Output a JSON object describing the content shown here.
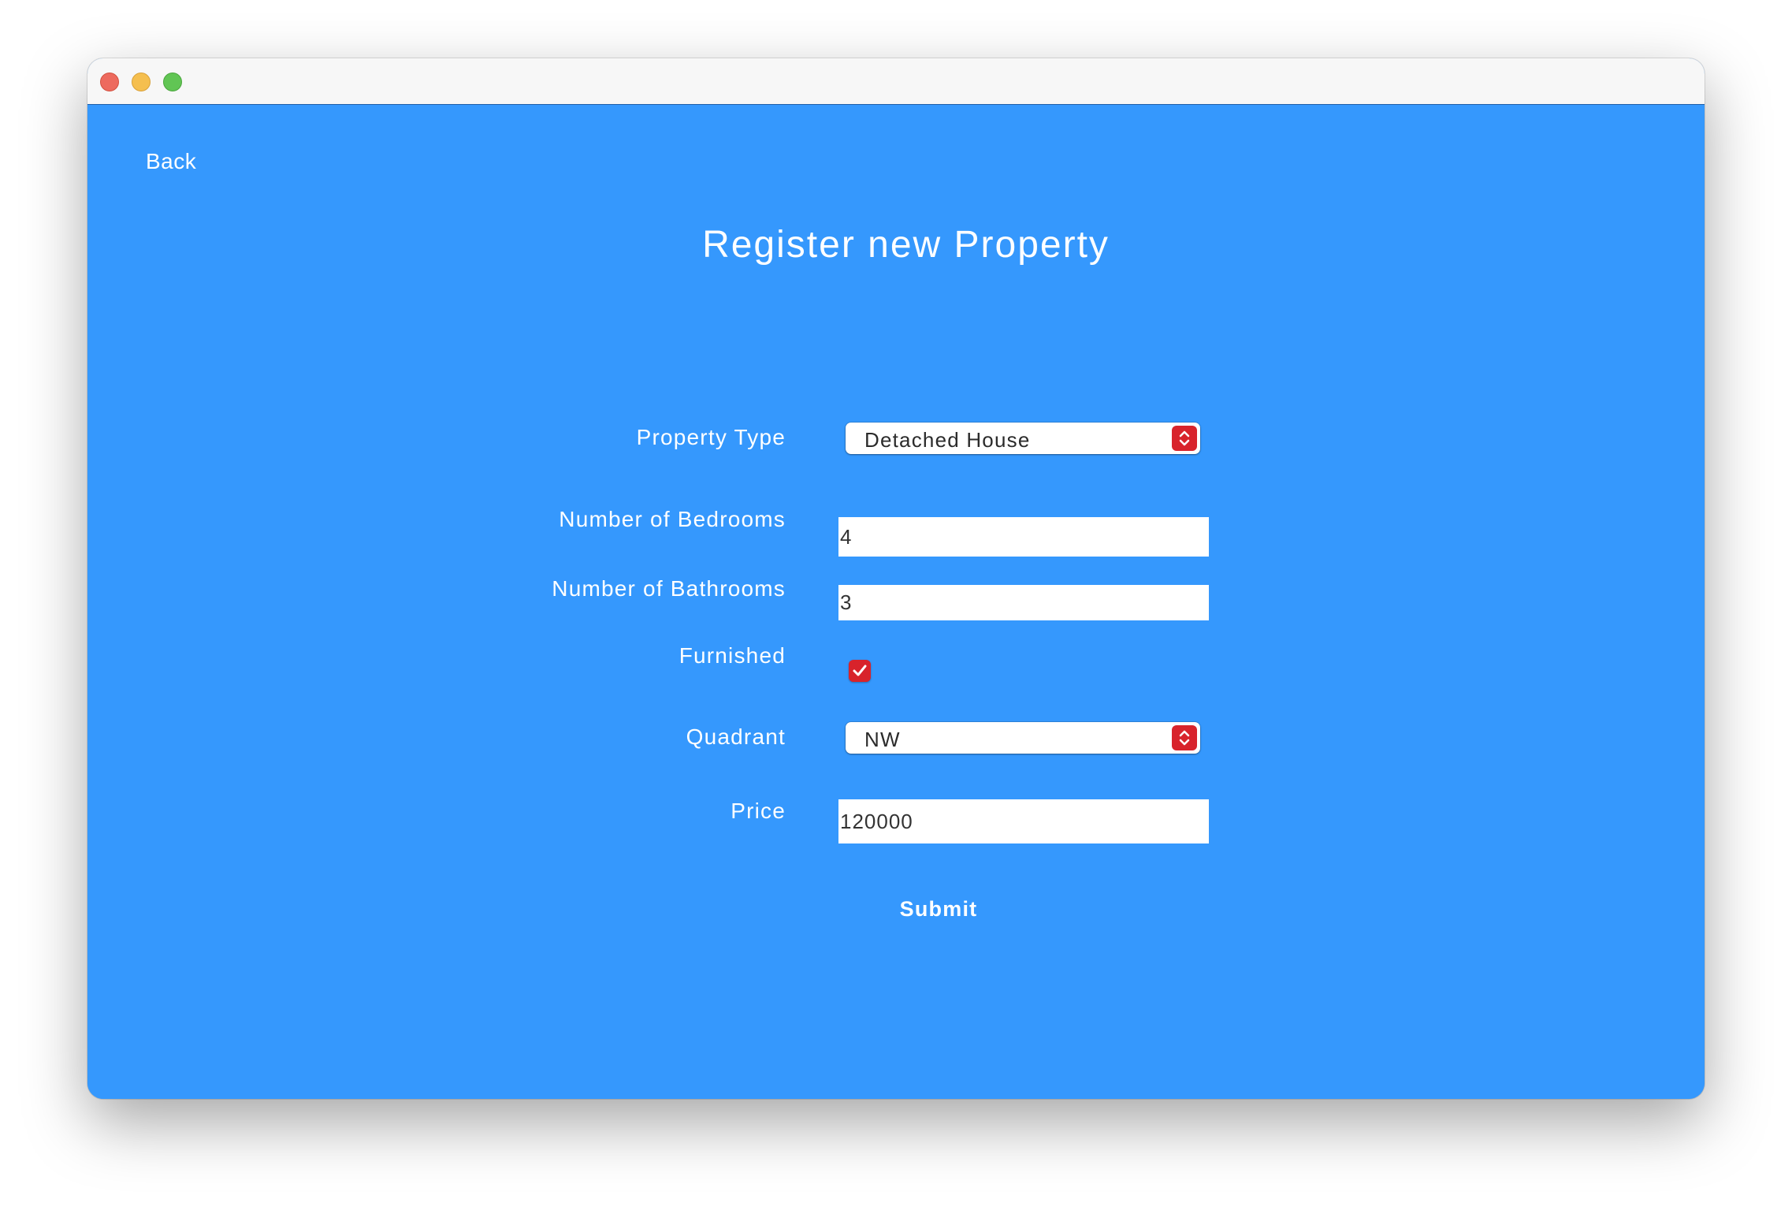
{
  "window": {
    "controls": [
      "close",
      "minimize",
      "maximize"
    ]
  },
  "nav": {
    "back_label": "Back"
  },
  "page": {
    "title": "Register new Property"
  },
  "form": {
    "property_type": {
      "label": "Property Type",
      "value": "Detached House",
      "icon": "up-down-chevron-icon"
    },
    "bedrooms": {
      "label": "Number of Bedrooms",
      "value": "4"
    },
    "bathrooms": {
      "label": "Number of Bathrooms",
      "value": "3"
    },
    "furnished": {
      "label": "Furnished",
      "checked": true,
      "icon": "checkmark-icon"
    },
    "quadrant": {
      "label": "Quadrant",
      "value": "NW",
      "icon": "up-down-chevron-icon"
    },
    "price": {
      "label": "Price",
      "value": "120000"
    },
    "submit_label": "Submit"
  },
  "colors": {
    "background": "#3598fd",
    "accent": "#d8232b",
    "text": "#ffffff"
  }
}
